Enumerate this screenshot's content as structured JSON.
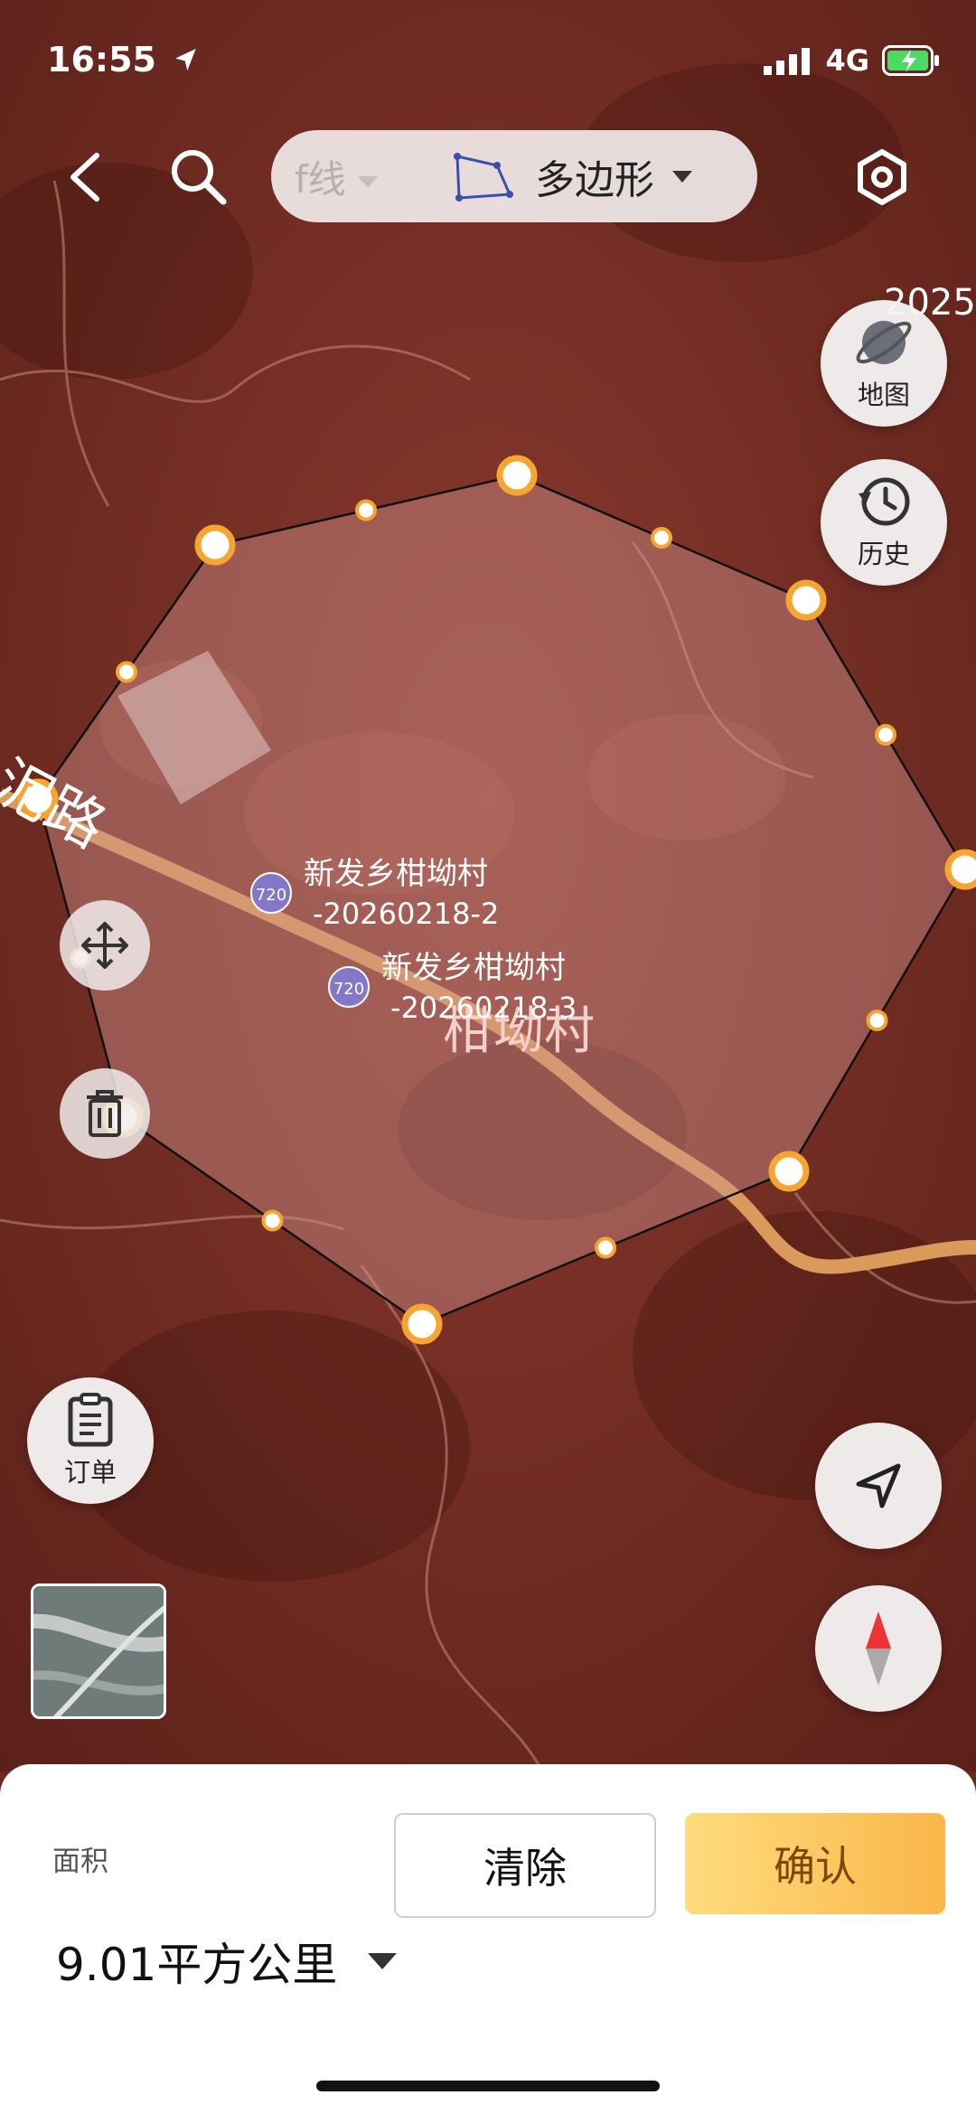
{
  "status": {
    "time": "16:55",
    "network": "4G"
  },
  "toolbar": {
    "prev_mode": "f线",
    "current_mode": "多边形"
  },
  "map": {
    "year_label": "2025",
    "road_label": "泥路",
    "road_number": "720",
    "village_label": "柑坳村",
    "marker_1": {
      "line1": "新发乡柑坳村",
      "line2": "-20260218-2"
    },
    "marker_2": {
      "line1": "新发乡柑坳村",
      "line2": "-20260218-3"
    }
  },
  "side_buttons": {
    "map": "地图",
    "history": "历史",
    "orders": "订单"
  },
  "bottom_panel": {
    "area_label": "面积",
    "area_value": "9.01平方公里",
    "clear_label": "清除",
    "confirm_label": "确认"
  },
  "colors": {
    "accent": "#f7a531",
    "confirm_start": "#ffdc7d",
    "confirm_end": "#f9b64a"
  }
}
